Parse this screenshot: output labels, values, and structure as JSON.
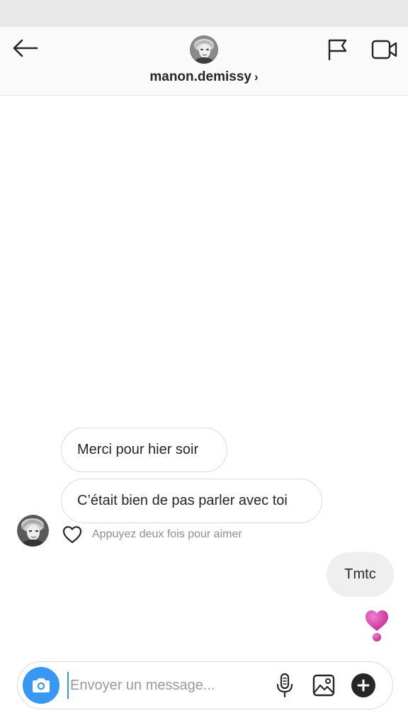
{
  "header": {
    "username": "manon.demissy",
    "chevron": "›"
  },
  "messages": {
    "incoming": [
      {
        "text": "Merci pour hier soir"
      },
      {
        "text": "C’était bien de pas parler avec toi"
      }
    ],
    "like_hint": "Appuyez deux fois pour aimer",
    "outgoing": [
      {
        "text": "Tmtc"
      }
    ],
    "sticker": "heavy-heart-exclamation-emoji"
  },
  "composer": {
    "placeholder": "Envoyer un message...",
    "value": ""
  },
  "icons": {
    "back": "arrow-left-icon",
    "report": "flag-icon",
    "video": "video-camera-icon",
    "camera": "camera-icon",
    "mic": "microphone-icon",
    "gallery": "image-icon",
    "more": "plus-icon",
    "like": "heart-outline-icon"
  },
  "colors": {
    "accent": "#3897f0",
    "heart_emoji": "#d63ea6",
    "incoming_border": "#dbdbdb",
    "outgoing_bg": "#efefef",
    "hint_text": "#8e8e8e"
  }
}
